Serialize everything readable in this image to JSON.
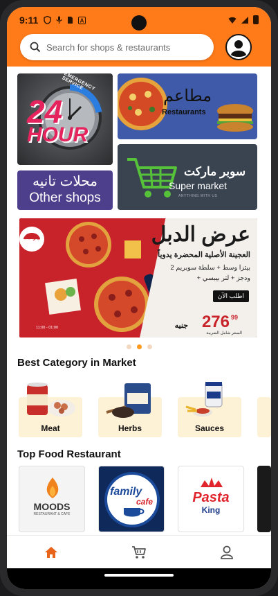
{
  "status_bar": {
    "time": "9:11"
  },
  "search": {
    "placeholder": "Search for shops & restaurants"
  },
  "tiles": {
    "hours": {
      "big": "24",
      "word": "HOUR",
      "ring": "EMERGENCY SERVICE"
    },
    "restaurants": {
      "ar": "مطاعم",
      "en": "Restaurants"
    },
    "other_shops": {
      "ar": "محلات تانيه",
      "en": "Other shops"
    },
    "supermarket": {
      "ar": "سوبر ماركت",
      "en": "Super market",
      "tag": "ANYTHING WITH US"
    }
  },
  "banner": {
    "logo": "بيتزا هت",
    "title": "عرض الدبل",
    "subtitle": "العجينة الأصلية المحضرة يدوياً",
    "line1": "2 بيتزا وسط + سلطة سوبريم",
    "line2": "+ ودجز + لتر بيبسي",
    "cta": "اطلب الآن",
    "price": "276",
    "cents": "99",
    "currency": "جنيه",
    "note": "السعر شامل الضريبة",
    "hours": "11:00 - 01:00"
  },
  "carousel": {
    "count": 3,
    "active": 1
  },
  "best_category": {
    "title": "Best Category in Market",
    "items": [
      {
        "label": "Meat"
      },
      {
        "label": "Herbs"
      },
      {
        "label": "Sauces"
      }
    ]
  },
  "top_food": {
    "title": "Top Food Restaurant",
    "items": [
      {
        "name": "MOODS",
        "sub": "RESTAURANT & CAFE"
      },
      {
        "name": "family",
        "sub": "cafe"
      },
      {
        "name": "Pasta",
        "sub": "King"
      }
    ]
  },
  "colors": {
    "accent": "#ff7a18",
    "nav_active": "#e8641a"
  },
  "nav": {
    "items": [
      {
        "icon": "home-icon"
      },
      {
        "icon": "cart-icon"
      },
      {
        "icon": "profile-icon"
      }
    ]
  }
}
